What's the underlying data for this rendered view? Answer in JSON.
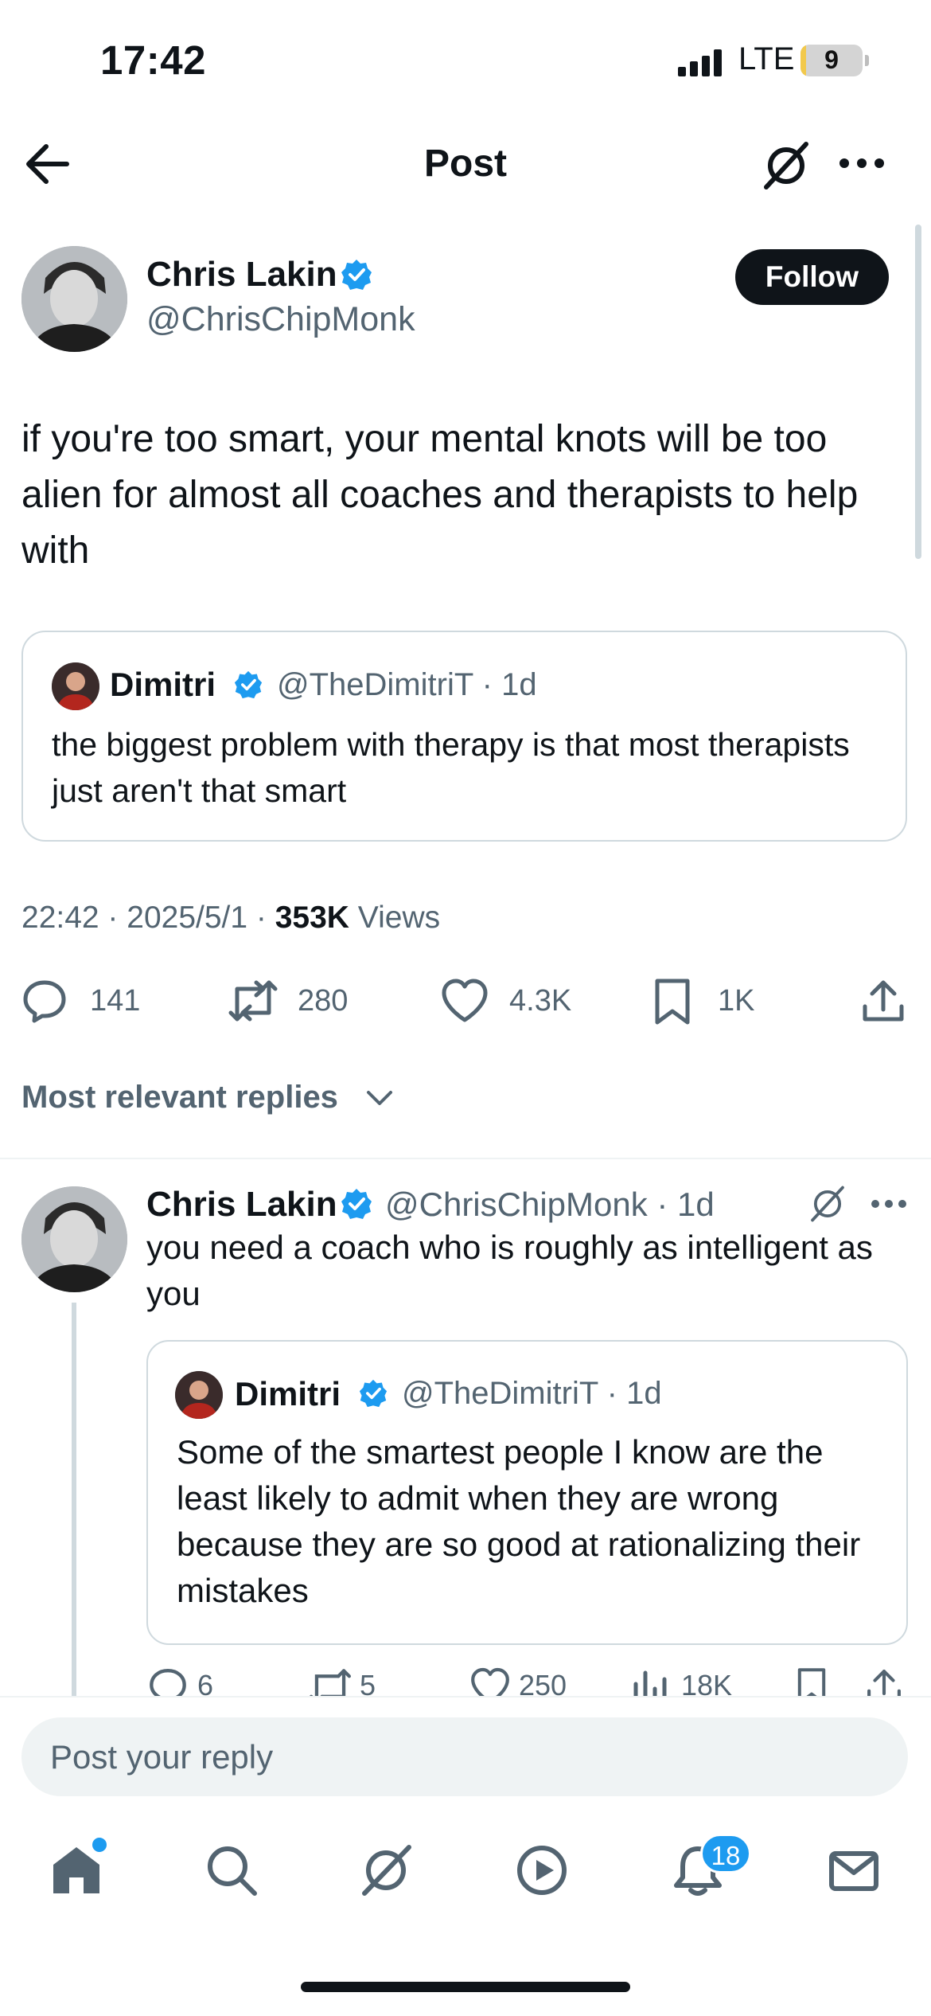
{
  "status_bar": {
    "time": "17:42",
    "network": "LTE",
    "battery": "9",
    "battery_level": 0.09
  },
  "header": {
    "title": "Post",
    "back_icon": "arrow-left-icon",
    "grok_icon": "grok-icon",
    "more_icon": "more-icon"
  },
  "post": {
    "author_name": "Chris Lakin",
    "author_handle": "@ChrisChipMonk",
    "follow_label": "Follow",
    "text": "if you're too smart, your mental knots will be too alien for almost all coaches and therapists to help with",
    "quote": {
      "name": "Dimitri",
      "handle_time": "@TheDimitriT · 1d",
      "text": "the biggest problem with therapy is that most therapists just aren't that smart"
    },
    "meta_time": "22:42 · 2025/5/1 · ",
    "views_count": "353K",
    "views_label": " Views",
    "stats": {
      "replies": "141",
      "reposts": "280",
      "likes": "4.3K",
      "bookmarks": "1K"
    }
  },
  "replies_sort": "Most relevant replies",
  "reply": {
    "author_name": "Chris Lakin",
    "handle_time": "@ChrisChipMonk · 1d",
    "text": "you need a coach who is roughly as intelligent as you",
    "quote": {
      "name": "Dimitri",
      "handle_time": "@TheDimitriT · 1d",
      "text": "Some of the smartest people I know are the least likely to admit when they are wrong because they are so good at rationalizing their mistakes"
    },
    "stats": {
      "replies": "6",
      "reposts": "5",
      "likes": "250",
      "views": "18K"
    }
  },
  "composer": {
    "placeholder": "Post your reply"
  },
  "nav": {
    "notifications_badge": "18"
  },
  "colors": {
    "accent": "#1d9bf0",
    "text": "#0f1419",
    "secondary": "#536471",
    "border": "#cfd9de"
  }
}
